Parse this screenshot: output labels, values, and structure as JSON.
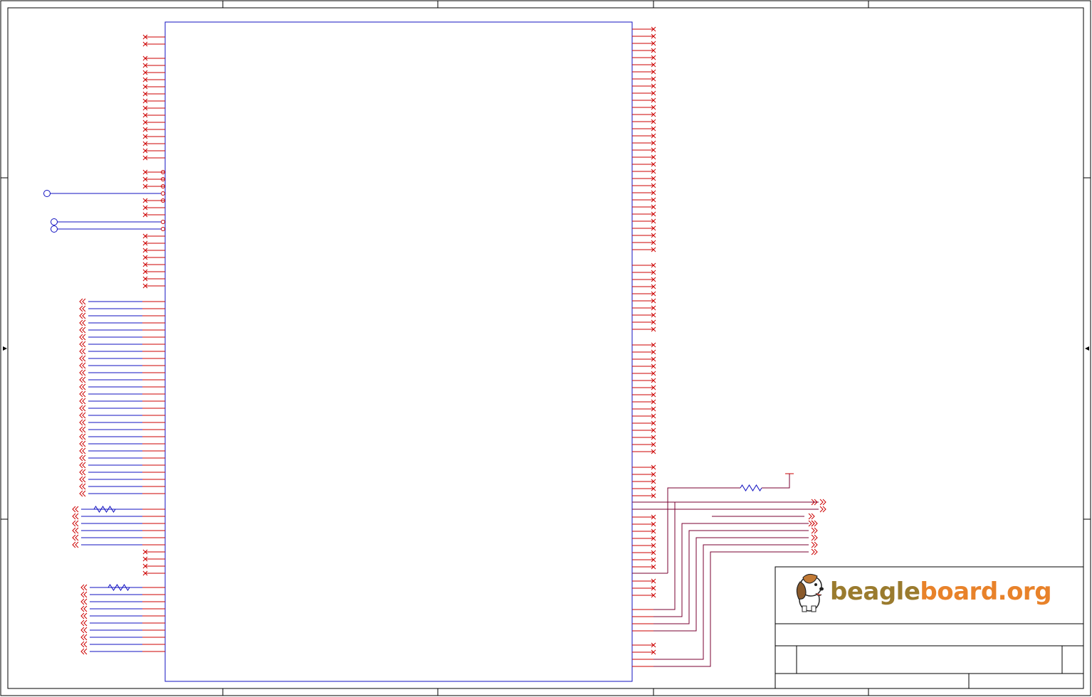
{
  "sheet": {
    "colors": {
      "frame": "#000000",
      "body": "#1010c0",
      "pin": "#cc0000",
      "noconnect": "#cc0000",
      "wire": "#7a0030",
      "logo_brown": "#9a7b2e",
      "logo_orange": "#e8822a"
    }
  },
  "title_block": {
    "logo": {
      "name": "beagleboard-logo",
      "text_beagle": "beagle",
      "text_board": "board",
      "text_org": ".org",
      "mascot_icon": "beagle-dog-icon"
    }
  }
}
